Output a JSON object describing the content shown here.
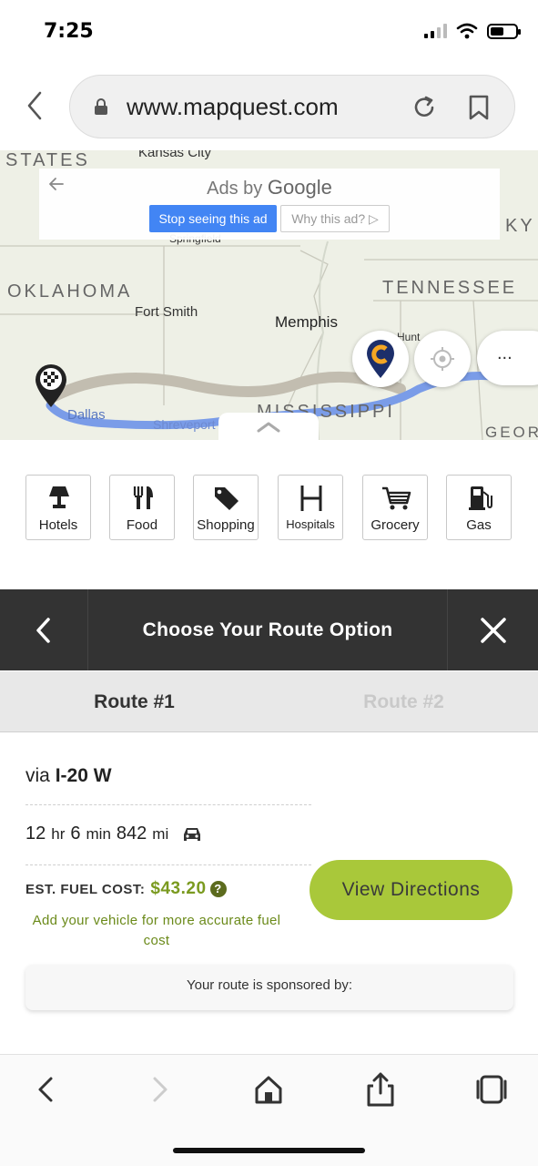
{
  "status_bar": {
    "time": "7:25"
  },
  "browser": {
    "url": "www.mapquest.com"
  },
  "map": {
    "state_labels": [
      "STATES",
      "OKLAHOMA",
      "TENNESSEE",
      "MISSISSIPPI",
      "KY",
      "GEOR"
    ],
    "city_labels": [
      "Kansas City",
      "Springfield",
      "Fort Smith",
      "Memphis",
      "Dallas",
      "Shreveport",
      "Hunt"
    ],
    "ad": {
      "ads_by": "Ads by",
      "google": "Google",
      "stop_label": "Stop seeing this ad",
      "why_label": "Why this ad?"
    },
    "more_label": "..."
  },
  "categories": [
    {
      "label": "Hotels",
      "icon": "lamp-icon"
    },
    {
      "label": "Food",
      "icon": "fork-knife-icon"
    },
    {
      "label": "Shopping",
      "icon": "tag-icon"
    },
    {
      "label": "Hospitals",
      "icon": "hospital-icon"
    },
    {
      "label": "Grocery",
      "icon": "cart-icon"
    },
    {
      "label": "Gas",
      "icon": "fuel-pump-icon"
    }
  ],
  "route_panel": {
    "title": "Choose Your Route Option",
    "tabs": [
      {
        "label": "Route #1",
        "active": true
      },
      {
        "label": "Route #2",
        "active": false
      }
    ],
    "via_prefix": "via",
    "via_road": "I-20 W",
    "duration_hours": "12",
    "hours_unit": "hr",
    "duration_minutes": "6",
    "minutes_unit": "min",
    "distance": "842",
    "distance_unit": "mi",
    "fuel_label": "EST. FUEL COST:",
    "fuel_cost": "$43.20",
    "help_mark": "?",
    "vehicle_link": "Add your vehicle for more accurate fuel cost",
    "view_directions": "View Directions",
    "sponsor_text": "Your route is sponsored by:"
  },
  "colors": {
    "accent_green": "#a9c83a",
    "fuel_green": "#7a9a1f",
    "header_dark": "#333333",
    "route_blue": "#7a9ce8",
    "ad_blue": "#4285f4"
  }
}
